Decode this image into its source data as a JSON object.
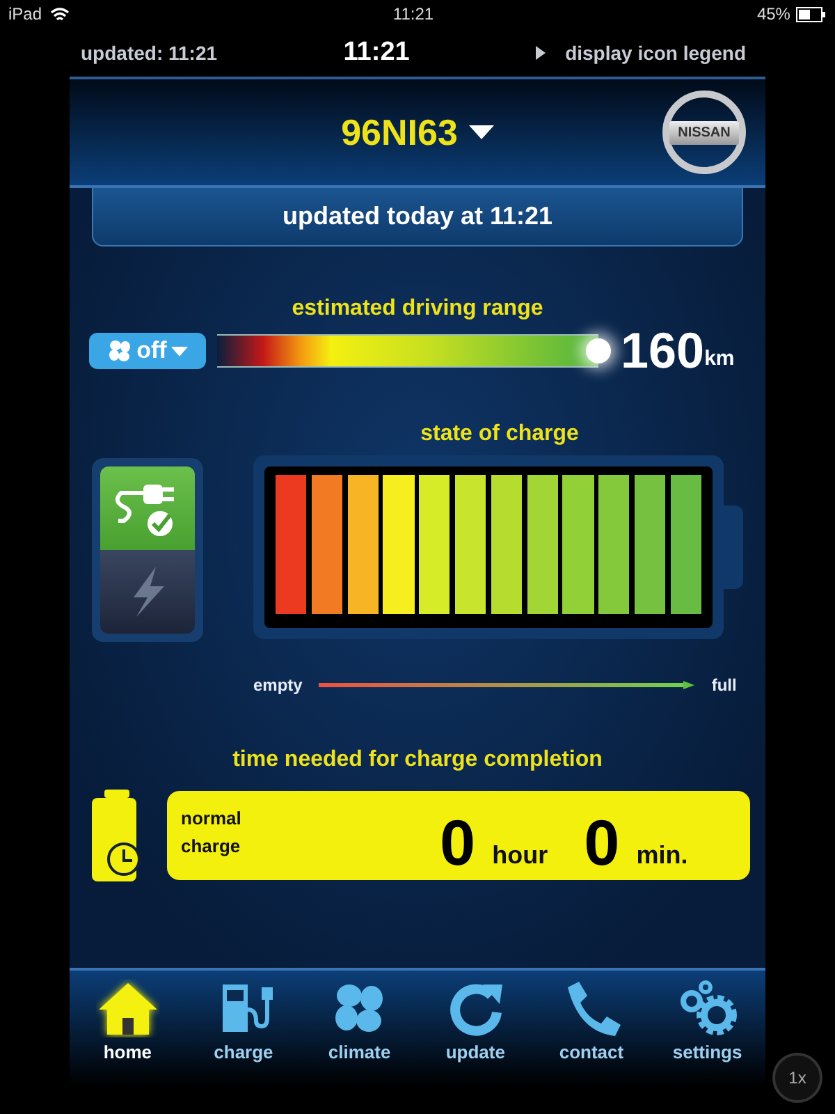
{
  "status_bar": {
    "device": "iPad",
    "time": "11:21",
    "battery": "45%"
  },
  "top_bar": {
    "updated": "updated:  11:21",
    "clock": "11:21",
    "legend_link": "display icon legend"
  },
  "header": {
    "vehicle": "96NI63",
    "logo_text": "NISSAN"
  },
  "update_banner": "updated today at 11:21",
  "range": {
    "title": "estimated driving range",
    "climate_button": "off",
    "value": "160",
    "unit": "km"
  },
  "charge": {
    "title": "state of charge",
    "empty_label": "empty",
    "full_label": "full",
    "modes": [
      {
        "kind": "plugged",
        "on": true
      },
      {
        "kind": "charging",
        "on": false
      }
    ]
  },
  "completion": {
    "title": "time needed for charge completion",
    "mode_label": "normal charge",
    "hours": "0",
    "hours_unit": "hour",
    "minutes": "0",
    "minutes_unit": "min."
  },
  "tabs": [
    {
      "kind": "home",
      "label": "home",
      "selected": true
    },
    {
      "kind": "charge",
      "label": "charge",
      "selected": false
    },
    {
      "kind": "climate",
      "label": "climate",
      "selected": false
    },
    {
      "kind": "update",
      "label": "update",
      "selected": false
    },
    {
      "kind": "contact",
      "label": "contact",
      "selected": false
    },
    {
      "kind": "settings",
      "label": "settings",
      "selected": false
    }
  ],
  "zoom_button": "1x"
}
